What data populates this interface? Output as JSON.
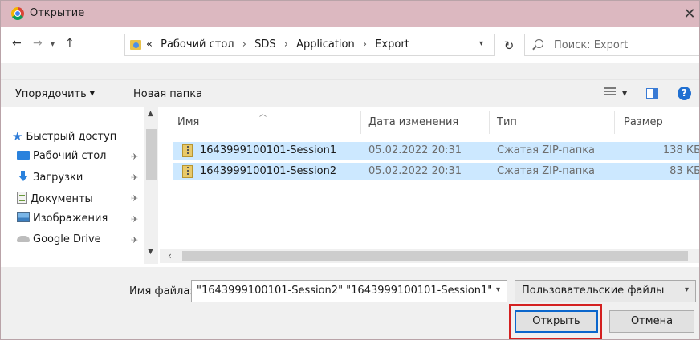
{
  "window": {
    "title": "Открытие",
    "close_glyph": "✕"
  },
  "nav": {
    "back_glyph": "←",
    "forward_glyph": "→",
    "recent_glyph": "⌄",
    "up_glyph": "↑",
    "breadcrumb_prefix": "«",
    "breadcrumb": [
      "Рабочий стол",
      "SDS",
      "Application",
      "Export"
    ],
    "separator": "›",
    "refresh_glyph": "↻",
    "search_placeholder": "Поиск: Export"
  },
  "toolbar": {
    "organize_label": "Упорядочить",
    "new_folder_label": "Новая папка",
    "help_glyph": "?"
  },
  "sidebar": {
    "items": [
      {
        "label": "Быстрый доступ",
        "icon": "star-icon",
        "pinned": false
      },
      {
        "label": "Рабочий стол",
        "icon": "desktop-icon",
        "pinned": true
      },
      {
        "label": "Загрузки",
        "icon": "download-icon",
        "pinned": true
      },
      {
        "label": "Документы",
        "icon": "documents-icon",
        "pinned": true
      },
      {
        "label": "Изображения",
        "icon": "images-icon",
        "pinned": true
      },
      {
        "label": "Google Drive",
        "icon": "drive-icon",
        "pinned": true
      }
    ]
  },
  "filelist": {
    "columns": {
      "name": "Имя",
      "date": "Дата изменения",
      "type": "Тип",
      "size": "Размер"
    },
    "rows": [
      {
        "name": "1643999100101-Session1",
        "date": "05.02.2022 20:31",
        "type": "Сжатая ZIP-папка",
        "size": "138 КБ",
        "selected": true
      },
      {
        "name": "1643999100101-Session2",
        "date": "05.02.2022 20:31",
        "type": "Сжатая ZIP-папка",
        "size": "83 КБ",
        "selected": true
      }
    ]
  },
  "footer": {
    "filename_label": "Имя файла:",
    "filename_value": "\"1643999100101-Session2\" \"1643999100101-Session1\"",
    "filetype_value": "Пользовательские файлы",
    "open_label": "Открыть",
    "cancel_label": "Отмена"
  },
  "colors": {
    "titlebar": "#dcb8c0",
    "selection": "#cce8ff",
    "highlight_outline": "#d42020",
    "default_button_border": "#0b66cc"
  }
}
